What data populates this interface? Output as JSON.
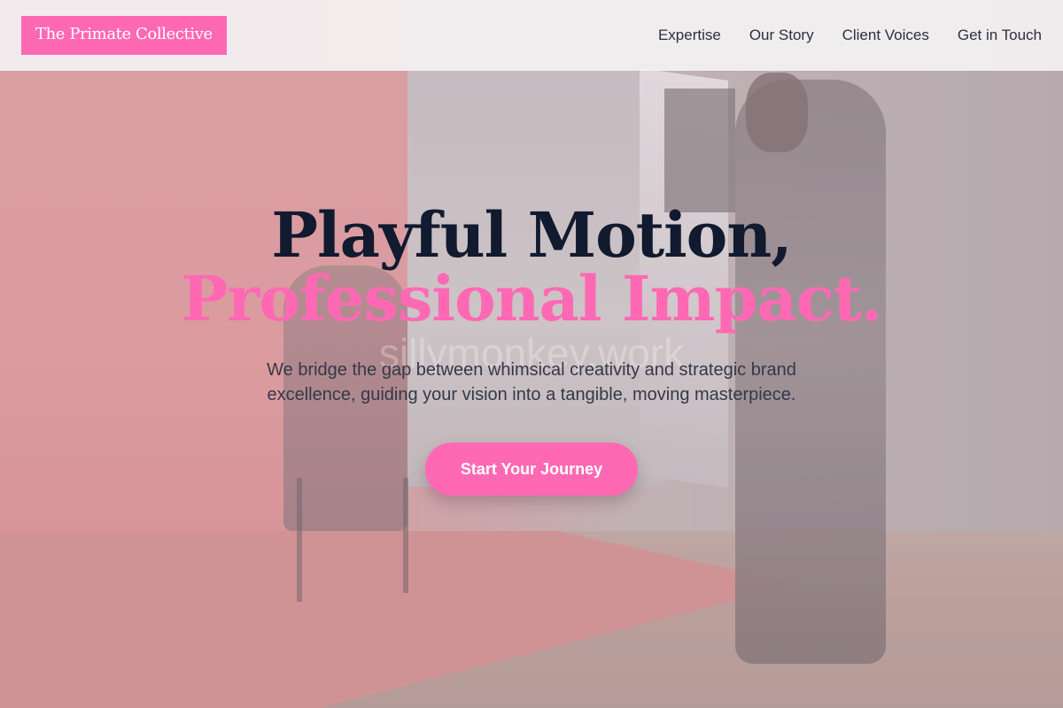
{
  "header": {
    "logo": "The Primate Collective",
    "nav": [
      {
        "label": "Expertise"
      },
      {
        "label": "Our Story"
      },
      {
        "label": "Client Voices"
      },
      {
        "label": "Get in Touch"
      }
    ]
  },
  "hero": {
    "headline_line1": "Playful Motion,",
    "headline_line2": "Professional Impact.",
    "background_watermark": "sillymonkey.work",
    "subtitle": "We bridge the gap between whimsical creativity and strategic brand excellence, guiding your vision into a tangible, moving masterpiece.",
    "cta_label": "Start Your Journey"
  },
  "colors": {
    "accent": "#ff69b4",
    "headline_dark": "#111a2e",
    "nav_text": "#2b2f3d"
  }
}
